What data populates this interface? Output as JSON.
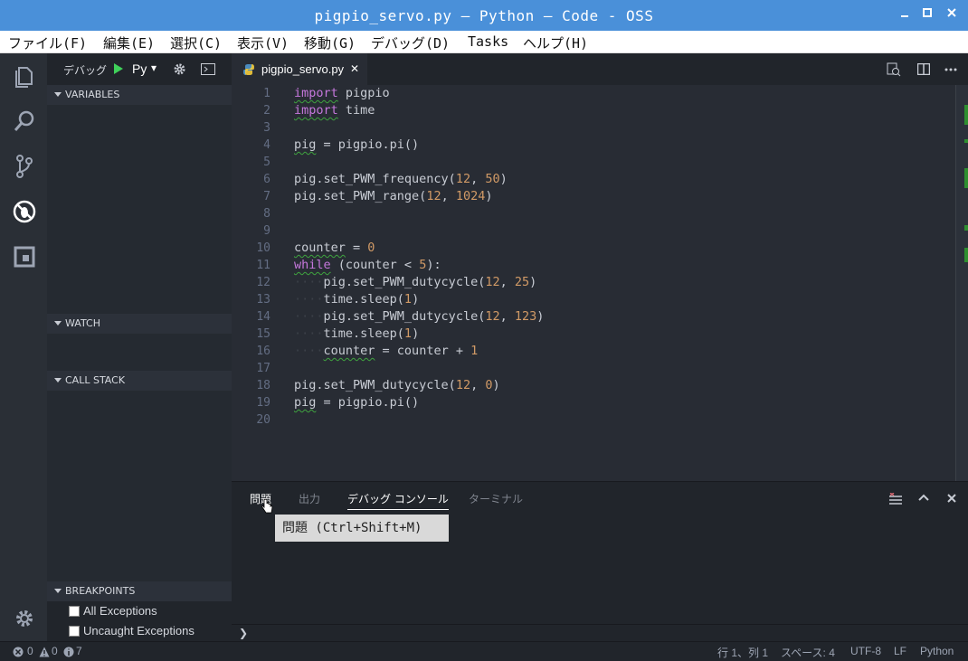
{
  "window": {
    "title": "pigpio_servo.py — Python — Code - OSS"
  },
  "menu": [
    "ファイル(F)",
    "編集(E)",
    "選択(C)",
    "表示(V)",
    "移動(G)",
    "デバッグ(D)",
    "Tasks",
    "ヘルプ(H)"
  ],
  "debug_toolbar": {
    "label": "デバッグ",
    "config": "Py",
    "dropdown_arrow": "▾"
  },
  "sidebar": {
    "variables": "VARIABLES",
    "watch": "WATCH",
    "callstack": "CALL STACK",
    "breakpoints": "BREAKPOINTS",
    "breakpoint_items": [
      "All Exceptions",
      "Uncaught Exceptions"
    ]
  },
  "editor_tab": {
    "filename": "pigpio_servo.py",
    "close": "✕"
  },
  "code": {
    "line_numbers": [
      "1",
      "2",
      "3",
      "4",
      "5",
      "6",
      "7",
      "8",
      "9",
      "10",
      "11",
      "12",
      "13",
      "14",
      "15",
      "16",
      "17",
      "18",
      "19",
      "20"
    ]
  },
  "panel": {
    "tabs": [
      "問題",
      "出力",
      "デバッグ コンソール",
      "ターミナル"
    ],
    "tooltip": "問題 (Ctrl+Shift+M)",
    "prompt": "❯"
  },
  "status": {
    "errors": "0",
    "warnings": "0",
    "infos": "7",
    "position": "行 1、列 1",
    "spaces": "スペース: 4",
    "encoding": "UTF-8",
    "eol": "LF",
    "language": "Python"
  },
  "colors": {
    "titlebar": "#4a90d9",
    "keyword": "#c678dd",
    "number": "#d19a66",
    "run": "#3fd15a"
  }
}
